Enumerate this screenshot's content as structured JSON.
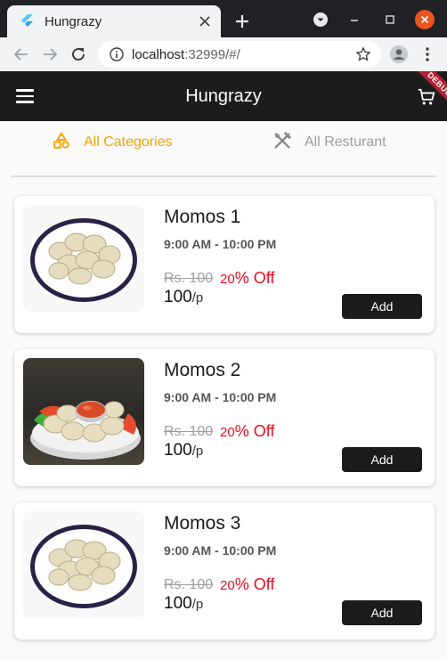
{
  "browser": {
    "tab_title": "Hungrazy",
    "url_host": "localhost",
    "url_rest": ":32999/#/"
  },
  "app": {
    "title": "Hungrazy",
    "debug_label": "DEBUG",
    "tabs": [
      {
        "label": "All Categories",
        "active": true,
        "icon": "categories-icon",
        "color": "#f5a100"
      },
      {
        "label": "All Resturant",
        "active": false,
        "icon": "restaurant-icon",
        "color": "#9e9e9e"
      }
    ],
    "items": [
      {
        "name": "Momos 1",
        "time": "9:00 AM - 10:00 PM",
        "old_price": "Rs. 100",
        "discount_num": "20",
        "discount_text": "% Off",
        "price": "100",
        "unit": "/p",
        "button": "Add",
        "image": "plate-momos"
      },
      {
        "name": "Momos 2",
        "time": "9:00 AM - 10:00 PM",
        "old_price": "Rs. 100",
        "discount_num": "20",
        "discount_text": "% Off",
        "price": "100",
        "unit": "/p",
        "button": "Add",
        "image": "bowl-momos-with-sauce"
      },
      {
        "name": "Momos 3",
        "time": "9:00 AM - 10:00 PM",
        "old_price": "Rs. 100",
        "discount_num": "20",
        "discount_text": "% Off",
        "price": "100",
        "unit": "/p",
        "button": "Add",
        "image": "plate-momos"
      }
    ]
  },
  "colors": {
    "accent": "#f5a100",
    "discount": "#e60d1e",
    "appbar": "#1c1c1c"
  }
}
